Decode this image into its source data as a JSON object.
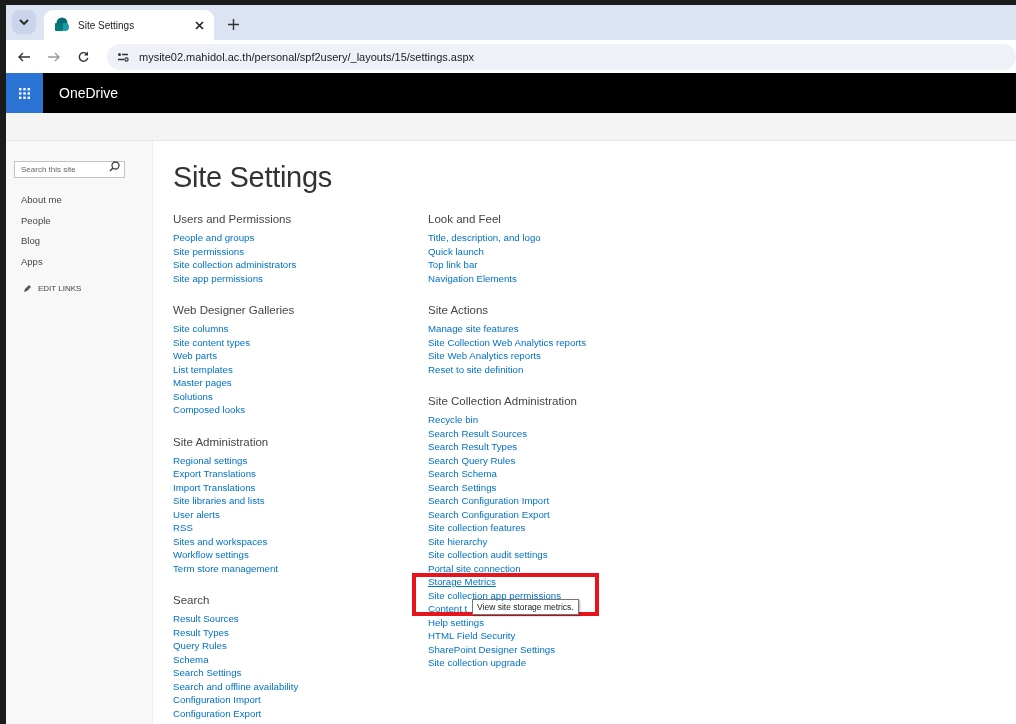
{
  "browser": {
    "tab": {
      "title": "Site Settings",
      "selected": true
    },
    "url": "mysite02.mahidol.ac.th/personal/spf2usery/_layouts/15/settings.aspx"
  },
  "suite_bar": {
    "title": "OneDrive"
  },
  "sidebar": {
    "search": {
      "placeholder": "Search this site"
    },
    "items": [
      "About me",
      "People",
      "Blog",
      "Apps"
    ],
    "edit_links": "EDIT LINKS"
  },
  "page_title": "Site Settings",
  "columns": [
    [
      {
        "heading": "Users and Permissions",
        "links": [
          {
            "text": "People and groups"
          },
          {
            "text": "Site permissions"
          },
          {
            "text": "Site collection administrators"
          },
          {
            "text": "Site app permissions"
          }
        ]
      },
      {
        "heading": "Web Designer Galleries",
        "links": [
          {
            "text": "Site columns"
          },
          {
            "text": "Site content types"
          },
          {
            "text": "Web parts"
          },
          {
            "text": "List templates"
          },
          {
            "text": "Master pages"
          },
          {
            "text": "Solutions"
          },
          {
            "text": "Composed looks"
          }
        ]
      },
      {
        "heading": "Site Administration",
        "links": [
          {
            "text": "Regional settings"
          },
          {
            "text": "Export Translations"
          },
          {
            "text": "Import Translations"
          },
          {
            "text": "Site libraries and lists"
          },
          {
            "text": "User alerts"
          },
          {
            "text": "RSS"
          },
          {
            "text": "Sites and workspaces"
          },
          {
            "text": "Workflow settings"
          },
          {
            "text": "Term store management"
          }
        ]
      },
      {
        "heading": "Search",
        "links": [
          {
            "text": "Result Sources"
          },
          {
            "text": "Result Types"
          },
          {
            "text": "Query Rules"
          },
          {
            "text": "Schema"
          },
          {
            "text": "Search Settings"
          },
          {
            "text": "Search and offline availability"
          },
          {
            "text": "Configuration Import"
          },
          {
            "text": "Configuration Export"
          }
        ]
      }
    ],
    [
      {
        "heading": "Look and Feel",
        "links": [
          {
            "text": "Title, description, and logo"
          },
          {
            "text": "Quick launch"
          },
          {
            "text": "Top link bar"
          },
          {
            "text": "Navigation Elements"
          }
        ]
      },
      {
        "heading": "Site Actions",
        "links": [
          {
            "text": "Manage site features"
          },
          {
            "text": "Site Collection Web Analytics reports"
          },
          {
            "text": "Site Web Analytics reports"
          },
          {
            "text": "Reset to site definition"
          }
        ]
      },
      {
        "heading": "Site Collection Administration",
        "links": [
          {
            "text": "Recycle bin"
          },
          {
            "text": "Search Result Sources"
          },
          {
            "text": "Search Result Types"
          },
          {
            "text": "Search Query Rules"
          },
          {
            "text": "Search Schema"
          },
          {
            "text": "Search Settings"
          },
          {
            "text": "Search Configuration Import"
          },
          {
            "text": "Search Configuration Export"
          },
          {
            "text": "Site collection features"
          },
          {
            "text": "Site hierarchy"
          },
          {
            "text": "Site collection audit settings"
          },
          {
            "text": "Portal site connection"
          },
          {
            "text": "Storage Metrics",
            "hovered": true,
            "highlighted": true,
            "tooltip": "View site storage metrics."
          },
          {
            "text": "Site collection app permissions"
          },
          {
            "text": "Content t"
          },
          {
            "text": "Help settings"
          },
          {
            "text": "HTML Field Security"
          },
          {
            "text": "SharePoint Designer Settings"
          },
          {
            "text": "Site collection upgrade"
          }
        ]
      }
    ]
  ]
}
